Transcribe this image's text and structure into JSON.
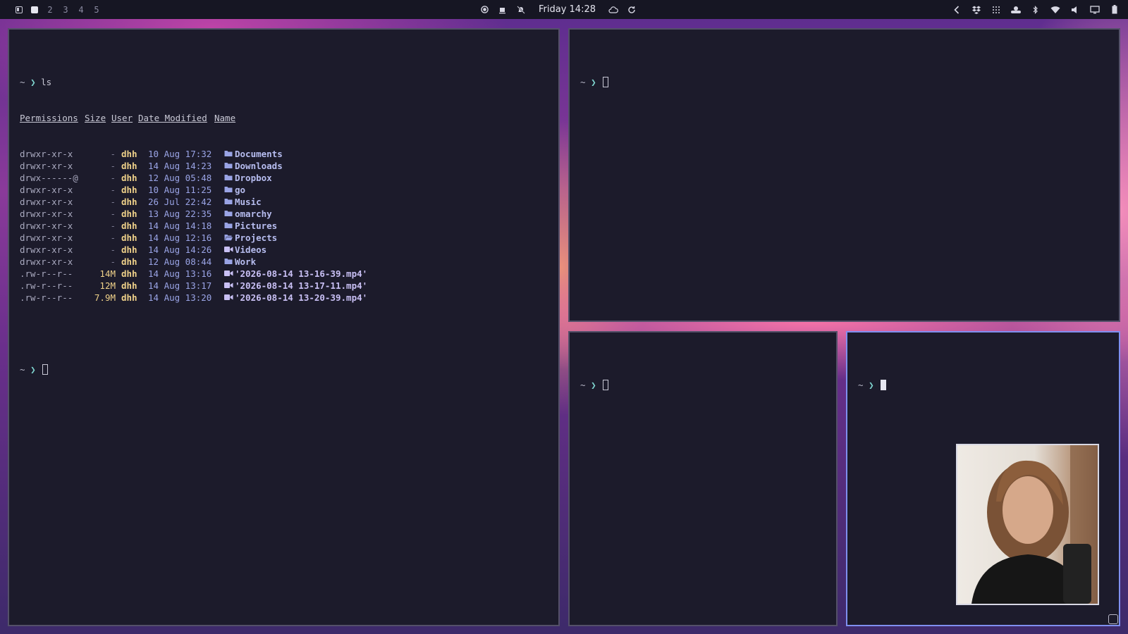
{
  "topbar": {
    "workspaces": [
      "2",
      "3",
      "4",
      "5"
    ],
    "clock": "Friday 14:28",
    "icons": [
      "app-launcher-icon",
      "active-workspace-icon",
      "record-icon",
      "coffee-icon",
      "notifications-off-icon",
      "cloud-icon",
      "refresh-icon",
      "chevron-left-icon",
      "dropbox-icon",
      "apps-grid-icon",
      "weather-icon",
      "bluetooth-icon",
      "wifi-icon",
      "volume-icon",
      "display-icon",
      "battery-icon"
    ]
  },
  "terminals": {
    "main": {
      "prompt_symbol": "~",
      "command": "ls",
      "headers": {
        "permissions": "Permissions",
        "size": "Size",
        "user": "User",
        "date": "Date Modified",
        "name": "Name"
      },
      "rows": [
        {
          "perm": "drwxr-xr-x",
          "size": "-",
          "user": "dhh",
          "date": "10 Aug 17:32",
          "icon": "folder-icon",
          "name": "Documents"
        },
        {
          "perm": "drwxr-xr-x",
          "size": "-",
          "user": "dhh",
          "date": "14 Aug 14:23",
          "icon": "folder-icon",
          "name": "Downloads"
        },
        {
          "perm": "drwx------@",
          "size": "-",
          "user": "dhh",
          "date": "12 Aug 05:48",
          "icon": "folder-icon",
          "name": "Dropbox"
        },
        {
          "perm": "drwxr-xr-x",
          "size": "-",
          "user": "dhh",
          "date": "10 Aug 11:25",
          "icon": "folder-icon",
          "name": "go"
        },
        {
          "perm": "drwxr-xr-x",
          "size": "-",
          "user": "dhh",
          "date": "26 Jul 22:42",
          "icon": "folder-icon",
          "name": "Music"
        },
        {
          "perm": "drwxr-xr-x",
          "size": "-",
          "user": "dhh",
          "date": "13 Aug 22:35",
          "icon": "folder-icon",
          "name": "omarchy"
        },
        {
          "perm": "drwxr-xr-x",
          "size": "-",
          "user": "dhh",
          "date": "14 Aug 14:18",
          "icon": "folder-icon",
          "name": "Pictures"
        },
        {
          "perm": "drwxr-xr-x",
          "size": "-",
          "user": "dhh",
          "date": "14 Aug 12:16",
          "icon": "folder-open-icon",
          "name": "Projects"
        },
        {
          "perm": "drwxr-xr-x",
          "size": "-",
          "user": "dhh",
          "date": "14 Aug 14:26",
          "icon": "video-folder-icon",
          "name": "Videos"
        },
        {
          "perm": "drwxr-xr-x",
          "size": "-",
          "user": "dhh",
          "date": "12 Aug 08:44",
          "icon": "folder-icon",
          "name": "Work"
        },
        {
          "perm": ".rw-r--r--",
          "size": "14M",
          "user": "dhh",
          "date": "14 Aug 13:16",
          "icon": "video-file-icon",
          "name": "'2026-08-14 13-16-39.mp4'"
        },
        {
          "perm": ".rw-r--r--",
          "size": "12M",
          "user": "dhh",
          "date": "14 Aug 13:17",
          "icon": "video-file-icon",
          "name": "'2026-08-14 13-17-11.mp4'"
        },
        {
          "perm": ".rw-r--r--",
          "size": "7.9M",
          "user": "dhh",
          "date": "14 Aug 13:20",
          "icon": "video-file-icon",
          "name": "'2026-08-14 13-20-39.mp4'"
        }
      ]
    },
    "prompt_text": "~ ❯ "
  },
  "colors": {
    "terminal_bg": "#1c1b2b",
    "focus_border": "#7f8ff0",
    "user_color": "#f0d28a",
    "name_color": "#b7bdf0"
  }
}
